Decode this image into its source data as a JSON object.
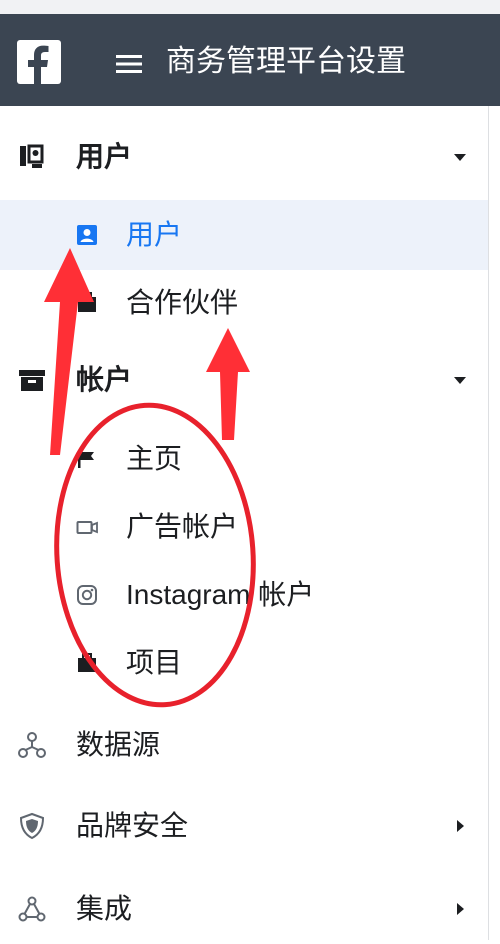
{
  "header": {
    "title": "商务管理平台设置",
    "logo_icon": "facebook-icon",
    "menu_icon": "hamburger-icon",
    "background": "#3b4552"
  },
  "menu": {
    "users_section": {
      "label": "用户",
      "icon": "users-icon",
      "expanded": true,
      "items": [
        {
          "label": "用户",
          "icon": "user-card-icon",
          "selected": true
        },
        {
          "label": "合作伙伴",
          "icon": "partner-icon",
          "selected": false
        }
      ]
    },
    "accounts_section": {
      "label": "帐户",
      "icon": "archive-icon",
      "expanded": true,
      "items": [
        {
          "label": "主页",
          "icon": "flag-icon"
        },
        {
          "label": "广告帐户",
          "icon": "ad-account-icon"
        },
        {
          "label": "Instagram 帐户",
          "icon": "instagram-icon"
        },
        {
          "label": "项目",
          "icon": "briefcase-icon"
        }
      ]
    },
    "data_sources": {
      "label": "数据源",
      "icon": "data-sources-icon"
    },
    "brand_safety": {
      "label": "品牌安全",
      "icon": "shield-icon"
    },
    "integrations": {
      "label": "集成",
      "icon": "integrations-icon"
    }
  },
  "colors": {
    "accent": "#1877f2",
    "selected_bg": "#edf2fa",
    "annotation": "#e8212c"
  }
}
